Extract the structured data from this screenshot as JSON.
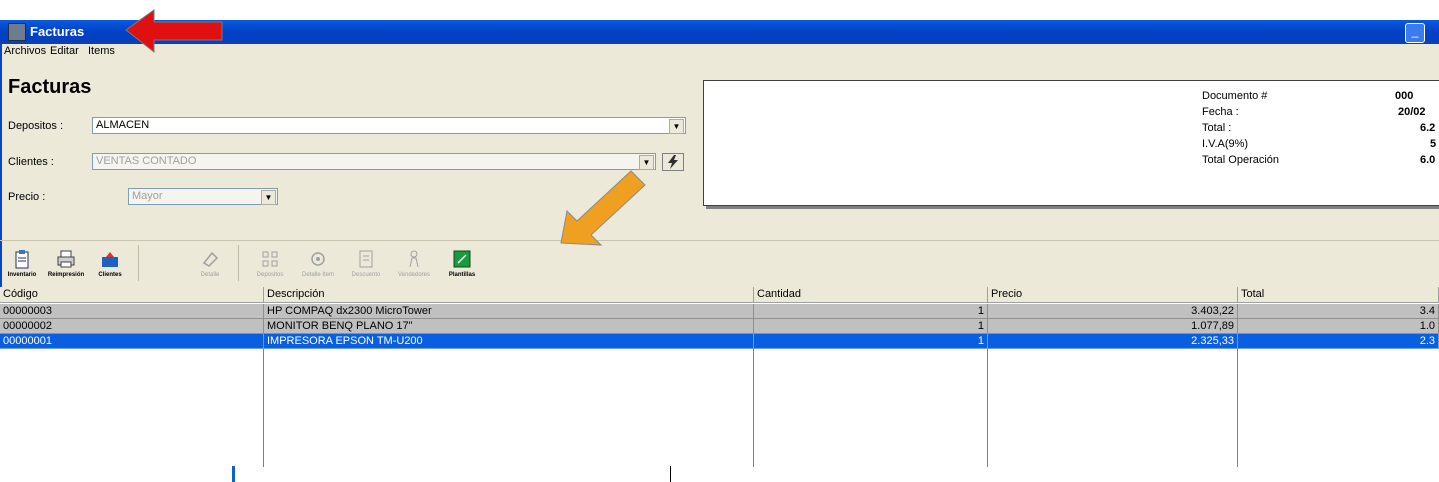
{
  "window": {
    "title": "Facturas",
    "min_glyph": "_"
  },
  "menu": [
    "Archivos",
    "Editar",
    "Items"
  ],
  "form": {
    "title": "Facturas",
    "depositos_label": "Depositos :",
    "depositos_value": "ALMACEN",
    "clientes_label": "Clientes :",
    "clientes_value": "VENTAS CONTADO",
    "precio_label": "Precio :",
    "precio_value": "Mayor"
  },
  "summary": [
    {
      "label": "Documento #",
      "value": "000"
    },
    {
      "label": "Fecha :",
      "value": "20/02"
    },
    {
      "label": "Total :",
      "value": "6.2"
    },
    {
      "label": "I.V.A(9%)",
      "value": "5"
    },
    {
      "label": "Total Operación",
      "value": "6.0"
    }
  ],
  "toolbar": [
    {
      "label": "Inventario",
      "icon": "clipboard-icon",
      "enabled": true
    },
    {
      "label": "Reimpresión",
      "icon": "printer-icon",
      "enabled": true
    },
    {
      "label": "Clientes",
      "icon": "clients-icon",
      "enabled": true
    },
    {
      "label": "Detalle",
      "icon": "tag-icon",
      "enabled": false
    },
    {
      "label": "Depositos",
      "icon": "grid-icon",
      "enabled": false
    },
    {
      "label": "Detalle Item",
      "icon": "settings-icon",
      "enabled": false
    },
    {
      "label": "Descuento",
      "icon": "document-icon",
      "enabled": false
    },
    {
      "label": "Vendedores",
      "icon": "person-icon",
      "enabled": false
    },
    {
      "label": "Plantillas",
      "icon": "spreadsheet-icon",
      "enabled": true
    }
  ],
  "grid": {
    "headers": [
      "Código",
      "Descripción",
      "Cantidad",
      "Precio",
      "Total"
    ],
    "rows": [
      [
        "00000003",
        "HP COMPAQ dx2300 MicroTower",
        "1",
        "3.403,22",
        "3.4"
      ],
      [
        "00000002",
        "MONITOR BENQ PLANO 17\"",
        "1",
        "1.077,89",
        "1.0"
      ],
      [
        "00000001",
        "IMPRESORA EPSON TM-U200",
        "1",
        "2.325,33",
        "2.3"
      ]
    ]
  },
  "colors": {
    "titlebar": "#0042c8",
    "selection": "#0a5fe0",
    "annotation_red": "#e01010",
    "annotation_orange": "#f0a020"
  }
}
